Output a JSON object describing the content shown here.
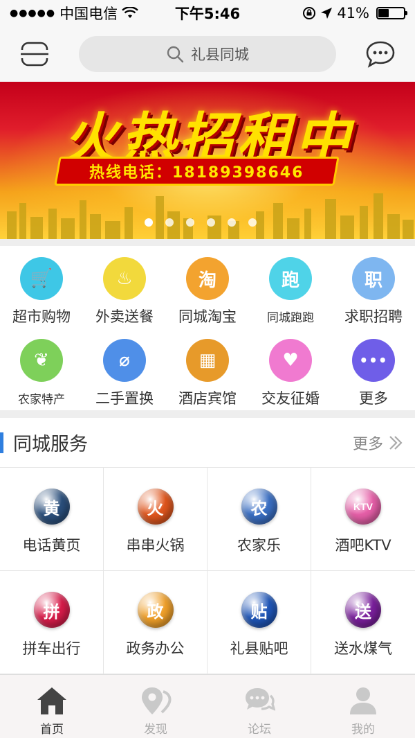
{
  "status_bar": {
    "carrier": "中国电信",
    "time": "下午5:46",
    "battery": "41%",
    "battery_level": 0.41
  },
  "header": {
    "search_placeholder": "礼县同城",
    "icons": [
      "scan-icon",
      "search-icon",
      "message-icon"
    ]
  },
  "banner": {
    "headline": "火热招租中",
    "hotline": "热线电话：18189398646",
    "page_count": 6,
    "active_page": 1
  },
  "categories": [
    {
      "label": "超市购物",
      "icon": "cart-icon",
      "color": "#3ec7e6",
      "glyph": "🛒"
    },
    {
      "label": "外卖送餐",
      "icon": "bowl-icon",
      "color": "#f2d93c",
      "glyph": "♨"
    },
    {
      "label": "同城淘宝",
      "icon": "tao-icon",
      "color": "#f3a32f",
      "glyph": "淘"
    },
    {
      "label": "同城跑跑",
      "icon": "run-icon",
      "color": "#4fd3e8",
      "glyph": "跑",
      "small": true
    },
    {
      "label": "求职招聘",
      "icon": "job-icon",
      "color": "#7eb6f0",
      "glyph": "职"
    },
    {
      "label": "农家特产",
      "icon": "leaf-icon",
      "color": "#7ed05a",
      "glyph": "❦",
      "small": true
    },
    {
      "label": "二手置换",
      "icon": "clip-icon",
      "color": "#4f8fe8",
      "glyph": "⌀"
    },
    {
      "label": "酒店宾馆",
      "icon": "hotel-icon",
      "color": "#e79a2a",
      "glyph": "▦"
    },
    {
      "label": "交友征婚",
      "icon": "heart-icon",
      "color": "#f07ad0",
      "glyph": "♥"
    },
    {
      "label": "更多",
      "icon": "more-icon",
      "color": "#6f5ee8",
      "glyph": "•••"
    }
  ],
  "services": {
    "title": "同城服务",
    "more_label": "更多",
    "items": [
      {
        "label": "电话黄页",
        "glyph": "黄",
        "color": "#2a4f7c"
      },
      {
        "label": "串串火锅",
        "glyph": "火",
        "color": "#e0561d"
      },
      {
        "label": "农家乐",
        "glyph": "农",
        "color": "#3a6fc4"
      },
      {
        "label": "酒吧KTV",
        "glyph": "KTV",
        "color": "#e65fa8"
      },
      {
        "label": "拼车出行",
        "glyph": "拼",
        "color": "#d81c4a"
      },
      {
        "label": "政务办公",
        "glyph": "政",
        "color": "#f0a02a"
      },
      {
        "label": "礼县贴吧",
        "glyph": "贴",
        "color": "#1f56b8"
      },
      {
        "label": "送水煤气",
        "glyph": "送",
        "color": "#7a1f9c"
      }
    ]
  },
  "tabbar": {
    "items": [
      {
        "label": "首页",
        "icon": "home-icon",
        "active": true
      },
      {
        "label": "发现",
        "icon": "location-icon",
        "active": false
      },
      {
        "label": "论坛",
        "icon": "forum-icon",
        "active": false
      },
      {
        "label": "我的",
        "icon": "user-icon",
        "active": false
      }
    ]
  }
}
